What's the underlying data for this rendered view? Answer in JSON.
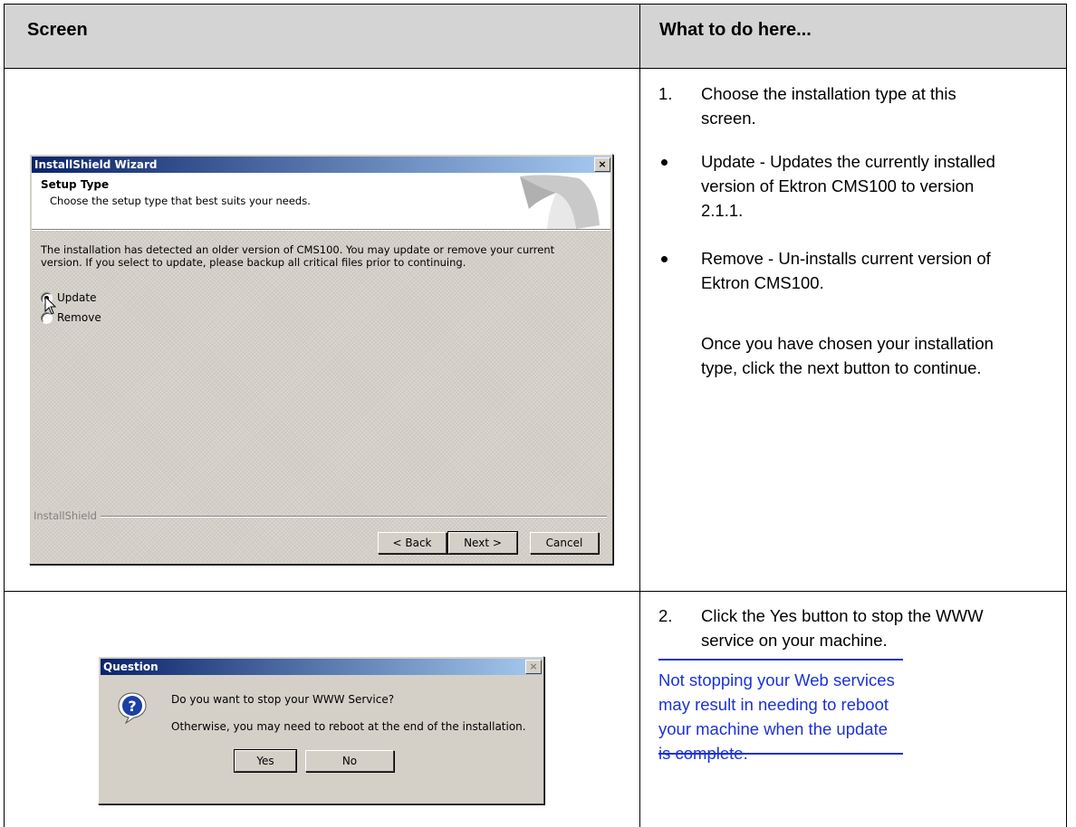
{
  "table": {
    "header_screen": "Screen",
    "header_todo": "What to do here..."
  },
  "row1": {
    "dialog": {
      "title": "InstallShield Wizard",
      "close_glyph": "×",
      "section_title": "Setup Type",
      "section_subtitle": "Choose the setup type that best suits your needs.",
      "body_text": "The installation has detected an older version of CMS100. You may update or remove your current version. If you select to update, please backup all critical files prior to continuing.",
      "options": [
        "Update",
        "Remove"
      ],
      "selected_option": "Update",
      "brand": "InstallShield",
      "back_label": "< Back",
      "next_label": "Next >",
      "cancel_label": "Cancel"
    },
    "step_number": "1.",
    "step_text": "Choose the installation type at this screen.",
    "bullets": [
      "Update - Updates the currently installed version of Ektron CMS100 to version 2.1.1.",
      "Remove - Un-installs current version of Ektron CMS100."
    ],
    "followup": "Once you have chosen your installation type, click the next button to continue."
  },
  "row2": {
    "dialog": {
      "title": "Question",
      "close_glyph": "×",
      "icon": "question-icon",
      "line1": "Do you want to stop your WWW Service?",
      "line2": "Otherwise, you may need to reboot at the end of the installation.",
      "yes_label": "Yes",
      "no_label": "No"
    },
    "step_number": "2.",
    "step_text": "Click the Yes button to stop the WWW service on your machine.",
    "note": "Not stopping your Web services may result in needing to reboot your machine when the update is complete."
  },
  "colors": {
    "header_bg": "#d4d4d4",
    "note_color": "#1a32d8",
    "titlebar_start": "#0a246a",
    "titlebar_end": "#a6caf0",
    "dialog_face": "#d4d0c8"
  }
}
